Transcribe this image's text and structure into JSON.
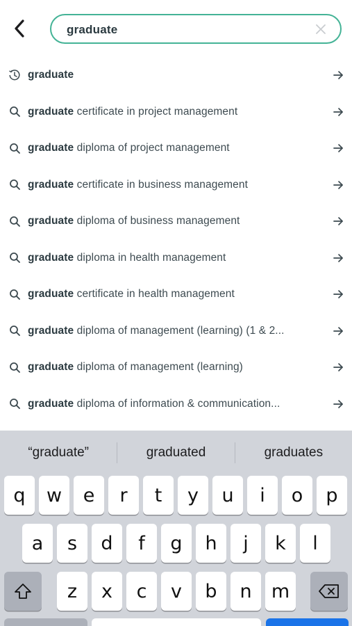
{
  "search": {
    "value": "graduate",
    "back_icon": "chevron-left-icon",
    "clear_icon": "close-icon",
    "accent_color": "#44b396"
  },
  "suggestions": [
    {
      "type": "history",
      "bold": "graduate",
      "rest": ""
    },
    {
      "type": "search",
      "bold": "graduate",
      "rest": " certificate in project management"
    },
    {
      "type": "search",
      "bold": "graduate",
      "rest": " diploma of project management"
    },
    {
      "type": "search",
      "bold": "graduate",
      "rest": " certificate in business management"
    },
    {
      "type": "search",
      "bold": "graduate",
      "rest": " diploma of business management"
    },
    {
      "type": "search",
      "bold": "graduate",
      "rest": " diploma in health management"
    },
    {
      "type": "search",
      "bold": "graduate",
      "rest": " certificate in health management"
    },
    {
      "type": "search",
      "bold": "graduate",
      "rest": " diploma of management (learning) (1 & 2..."
    },
    {
      "type": "search",
      "bold": "graduate",
      "rest": " diploma of management (learning)"
    },
    {
      "type": "search",
      "bold": "graduate",
      "rest": " diploma of information & communication..."
    }
  ],
  "keyboard": {
    "predictions": [
      "“graduate”",
      "graduated",
      "graduates"
    ],
    "row1": [
      "q",
      "w",
      "e",
      "r",
      "t",
      "y",
      "u",
      "i",
      "o",
      "p"
    ],
    "row2": [
      "a",
      "s",
      "d",
      "f",
      "g",
      "h",
      "j",
      "k",
      "l"
    ],
    "row3": [
      "z",
      "x",
      "c",
      "v",
      "b",
      "n",
      "m"
    ]
  }
}
